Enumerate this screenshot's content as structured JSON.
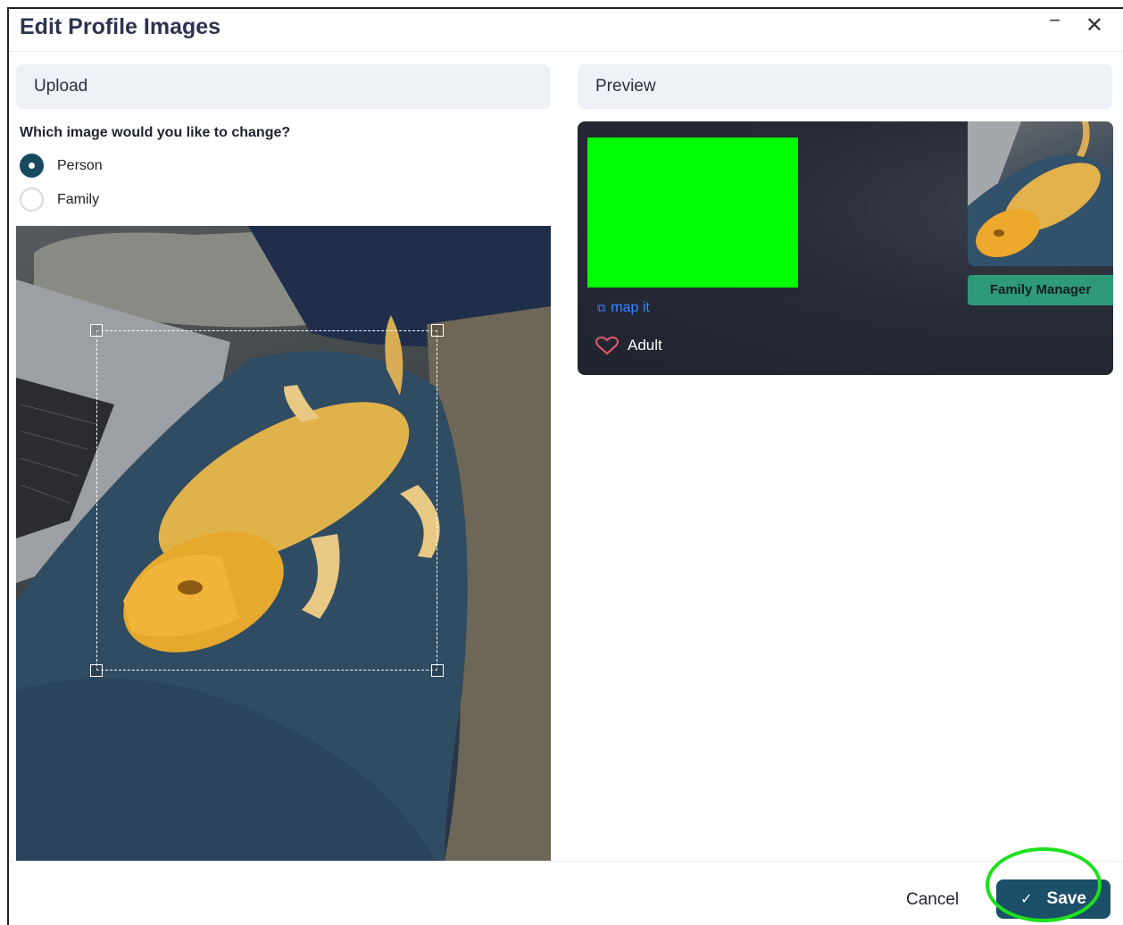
{
  "dialog": {
    "title": "Edit Profile Images",
    "minimize_label": "−",
    "close_label": "✕"
  },
  "upload": {
    "header": "Upload",
    "question": "Which image would you like to change?",
    "options": [
      {
        "label": "Person",
        "selected": true
      },
      {
        "label": "Family",
        "selected": false
      }
    ]
  },
  "preview": {
    "header": "Preview",
    "map_link": "map it",
    "status": "Adult",
    "role_badge": "Family Manager"
  },
  "footer": {
    "cancel_label": "Cancel",
    "save_label": "Save"
  },
  "colors": {
    "accent": "#1b5068",
    "placeholder_green": "#00ff00",
    "badge": "#2e9a7a",
    "link": "#3c84ff",
    "highlight": "#1ee01e"
  },
  "icons": [
    "minimize-icon",
    "close-icon",
    "external-link-icon",
    "heart-icon",
    "check-icon"
  ]
}
